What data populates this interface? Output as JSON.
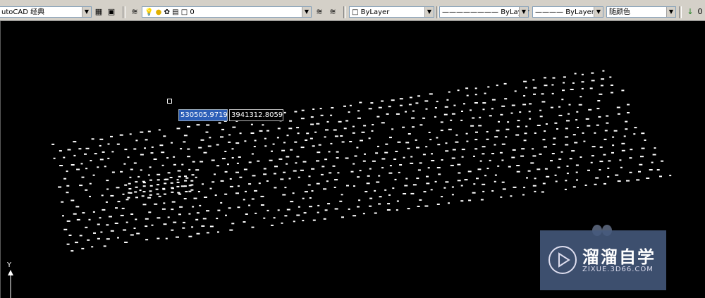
{
  "toolbar": {
    "workspace_value": "utoCAD 经典",
    "layer_value": "0",
    "color_value": "ByLayer",
    "linetype_value": "ByLayer",
    "lineweight_value": "ByLayer",
    "plotstyle_value": "随颜色",
    "right_value": "0"
  },
  "coord_input": {
    "x_value": "530505.9719",
    "y_value": "3941312.8059"
  },
  "ucs": {
    "y_label": "Y"
  },
  "watermark": {
    "title": "溜溜自学",
    "subtitle": "ZIXUE.3D66.COM"
  },
  "colors": {
    "canvas": "#000000",
    "points": "#ffffff",
    "toolbar": "#d4d0c8",
    "selection": "#2d5fb8"
  }
}
